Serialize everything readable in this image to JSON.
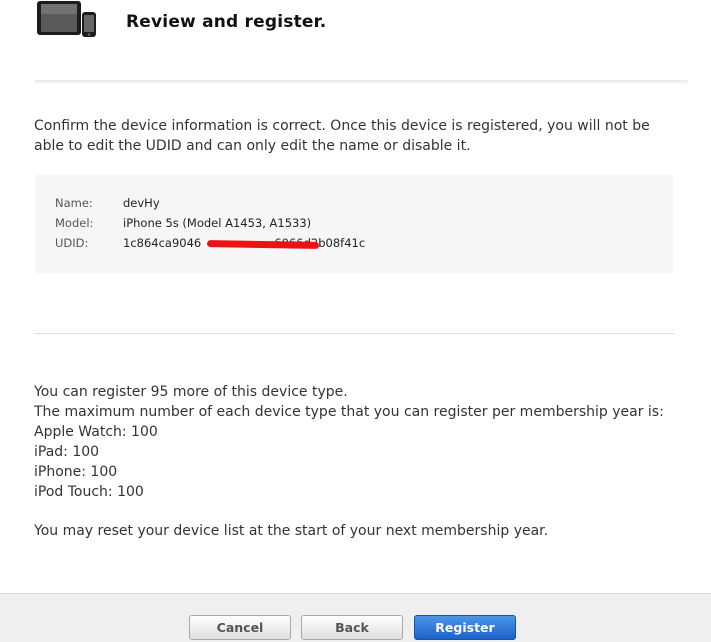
{
  "header": {
    "title": "Review and register."
  },
  "intro_text": "Confirm the device information is correct. Once this device is registered, you will not be able to edit the UDID and can only edit the name or disable it.",
  "device": {
    "name_label": "Name:",
    "name_value": "devHy",
    "model_label": "Model:",
    "model_value": "iPhone 5s (Model A1453, A1533)",
    "udid_label": "UDID:",
    "udid_value": "1c864ca9046                    6066d2b08f41c"
  },
  "limits": {
    "remaining": "You can register 95 more of this device type.",
    "max_intro": "The maximum number of each device type that you can register per membership year is:",
    "items": [
      "Apple Watch: 100",
      "iPad: 100",
      "iPhone: 100",
      "iPod Touch: 100"
    ]
  },
  "reset_note": "You may reset your device list at the start of your next membership year.",
  "buttons": {
    "cancel": "Cancel",
    "back": "Back",
    "register": "Register"
  },
  "colors": {
    "accent": "#1a62c7",
    "redaction": "#ee1111"
  },
  "icons": {
    "header": "ipad-and-iphone-icon"
  }
}
